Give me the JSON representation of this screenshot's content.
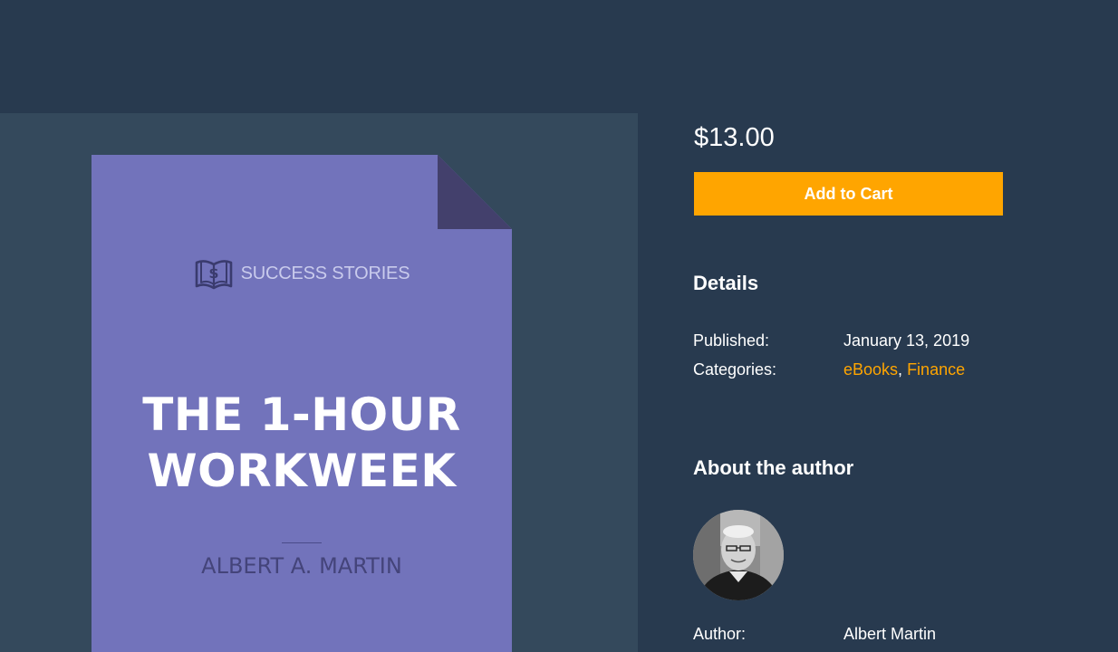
{
  "product": {
    "price": "$13.00",
    "add_to_cart_label": "Add to Cart"
  },
  "cover": {
    "brand": "SUCCESS STORIES",
    "title_line1": "THE 1-HOUR",
    "title_line2": "WORKWEEK",
    "author": "ALBERT A. MARTIN",
    "colors": {
      "background": "#7273bb",
      "fold": "#43406c",
      "brand": "#c9cbec"
    },
    "brand_icon": "book-dollar-icon"
  },
  "details": {
    "heading": "Details",
    "published_label": "Published:",
    "published_value": "January 13, 2019",
    "categories_label": "Categories:",
    "categories": [
      "eBooks",
      "Finance"
    ],
    "category_separator": ", "
  },
  "about_author": {
    "heading": "About the author",
    "author_label": "Author:",
    "author_name": "Albert Martin"
  },
  "colors": {
    "page_bg": "#283a4f",
    "panel_bg": "#34495c",
    "accent": "#ffa500"
  }
}
